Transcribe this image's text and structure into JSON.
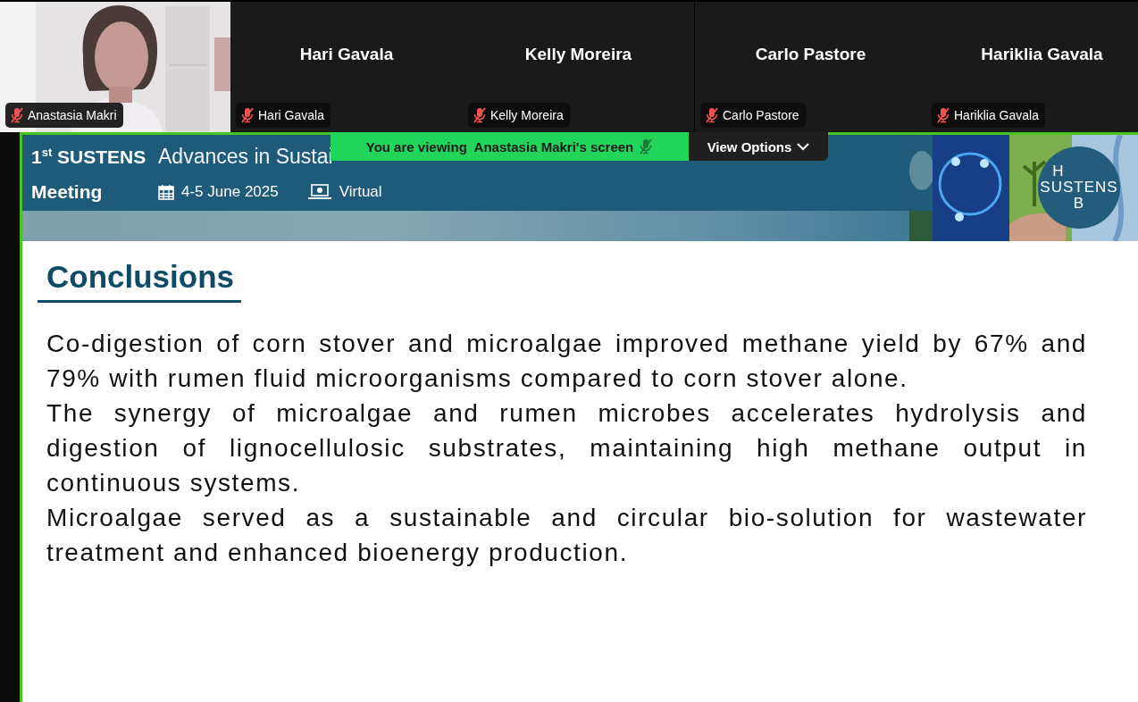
{
  "participants": [
    {
      "kind": "video",
      "label": "Anastasia Makri",
      "muted": true
    },
    {
      "kind": "name",
      "name": "Hari Gavala",
      "label": "Hari Gavala",
      "muted": true
    },
    {
      "kind": "name",
      "name": "Kelly Moreira",
      "label": "Kelly Moreira",
      "muted": true
    },
    {
      "kind": "name",
      "name": "Carlo Pastore",
      "label": "Carlo Pastore",
      "muted": true
    },
    {
      "kind": "name",
      "name": "Hariklia Gavala",
      "label": "Hariklia Gavala",
      "muted": true
    }
  ],
  "share_bar": {
    "text": "You are viewing  Anastasia Makri's screen",
    "muted": true
  },
  "view_options": {
    "label": "View Options"
  },
  "slide": {
    "header": {
      "series": "1$^{st}$ SUSTENS",
      "series_line2": "Meeting",
      "title": "Advances in Sustai",
      "date": "4-5 June 2025",
      "location": "Virtual",
      "logo": [
        "H",
        "SUSTENS",
        "B"
      ]
    },
    "heading": "Conclusions",
    "paragraphs": [
      "Co-digestion of corn stover and microalgae improved methane yield by 67% and 79% with rumen fluid microorganisms compared to corn stover alone.",
      "The synergy of microalgae and rumen microbes accelerates hydrolysis and digestion of lignocellulosic substrates, maintaining high methane output in continuous systems.",
      "Microalgae served as a sustainable and circular bio-solution for wastewater treatment and enhanced bioenergy production."
    ]
  }
}
